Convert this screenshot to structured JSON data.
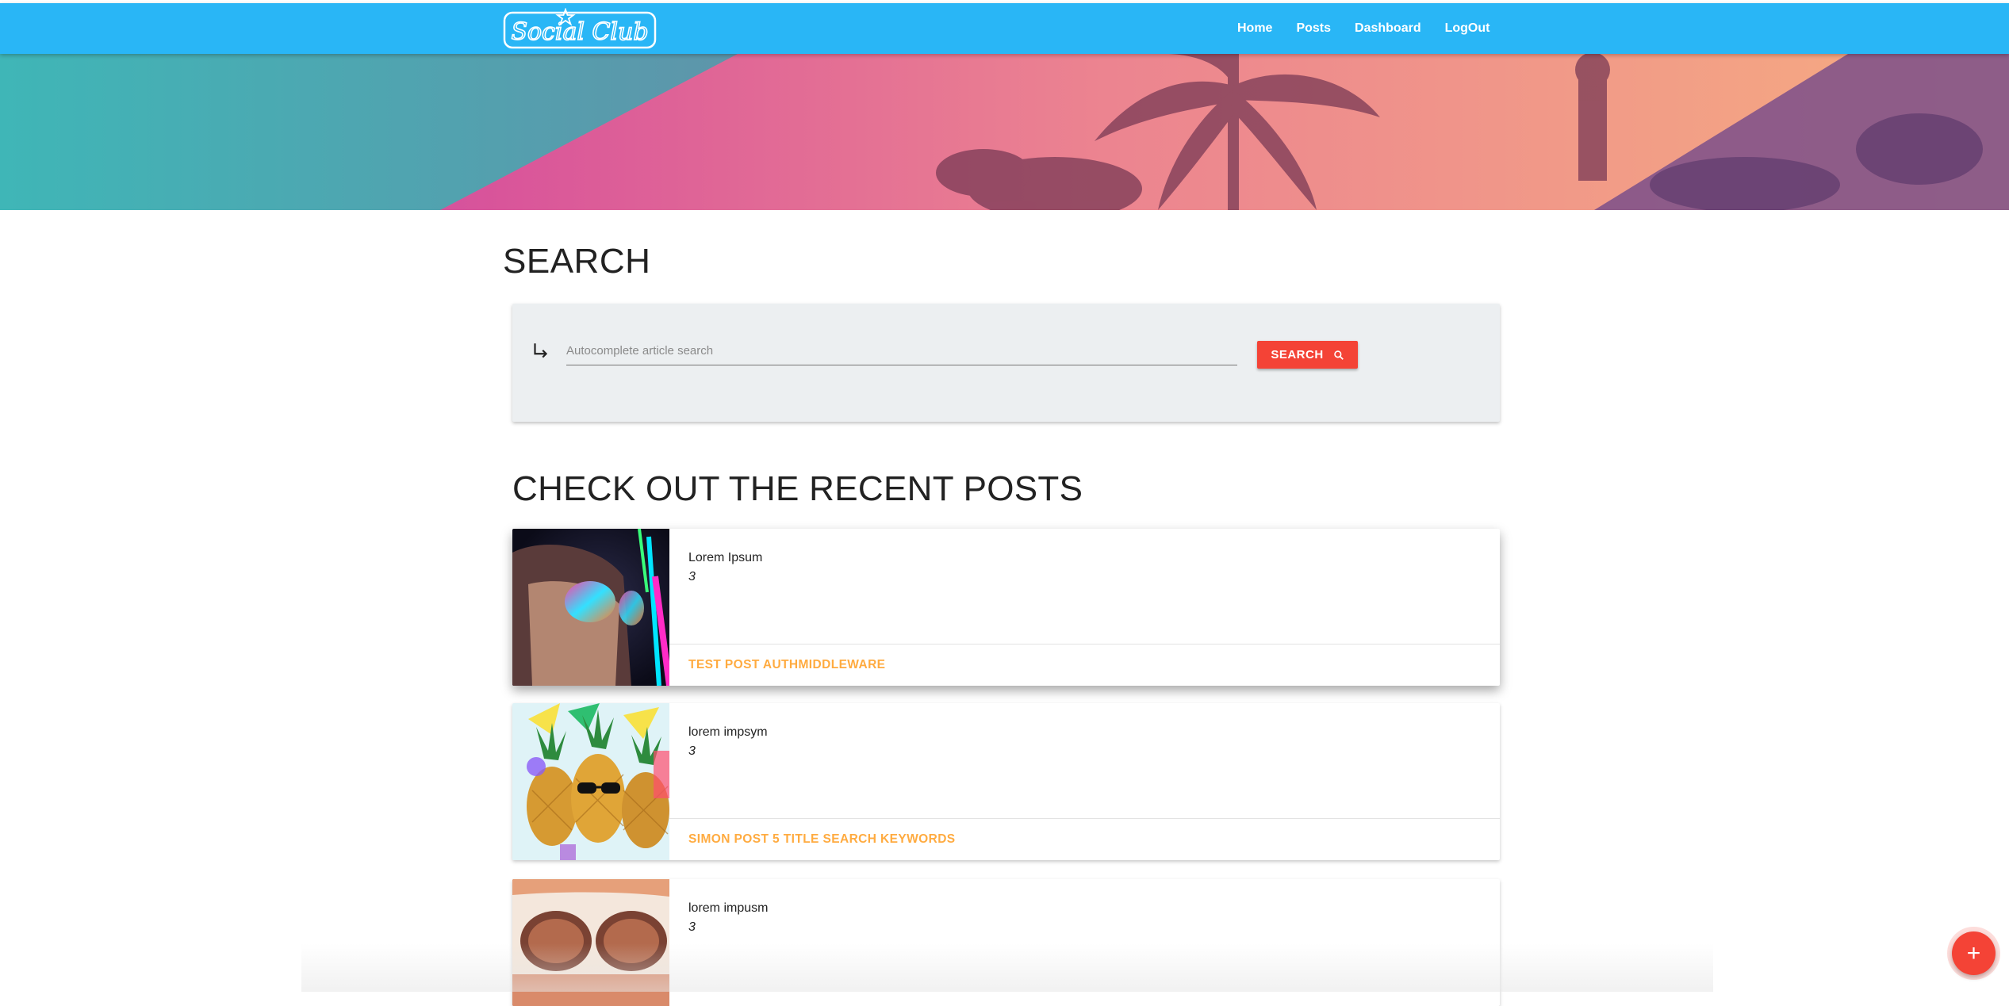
{
  "brand": {
    "logo_text": "Social Club"
  },
  "nav": {
    "items": [
      {
        "label": "Home"
      },
      {
        "label": "Posts"
      },
      {
        "label": "Dashboard"
      },
      {
        "label": "LogOut"
      }
    ]
  },
  "search": {
    "heading": "SEARCH",
    "placeholder": "Autocomplete article search",
    "button_label": "SEARCH",
    "arrow_icon": "subdirectory-arrow-right-icon",
    "button_icon": "search-icon"
  },
  "recent": {
    "heading": "CHECK OUT THE RECENT POSTS",
    "posts": [
      {
        "excerpt": "Lorem Ipsum",
        "count": "3",
        "title": "TEST POST AUTHMIDDLEWARE",
        "image": "woman-with-neon-sunglasses"
      },
      {
        "excerpt": "lorem impsym",
        "count": "3",
        "title": "SIMON POST 5 TITLE SEARCH KEYWORDS",
        "image": "pineapples-with-party-hats"
      },
      {
        "excerpt": "lorem impusm",
        "count": "3",
        "title": "",
        "image": "face-with-white-sunglasses"
      }
    ]
  },
  "fab": {
    "label": "+",
    "icon": "add-icon"
  },
  "colors": {
    "navbar": "#29b6f6",
    "search_button": "#f44336",
    "post_title": "#ffab40",
    "search_card": "#eceff1"
  }
}
